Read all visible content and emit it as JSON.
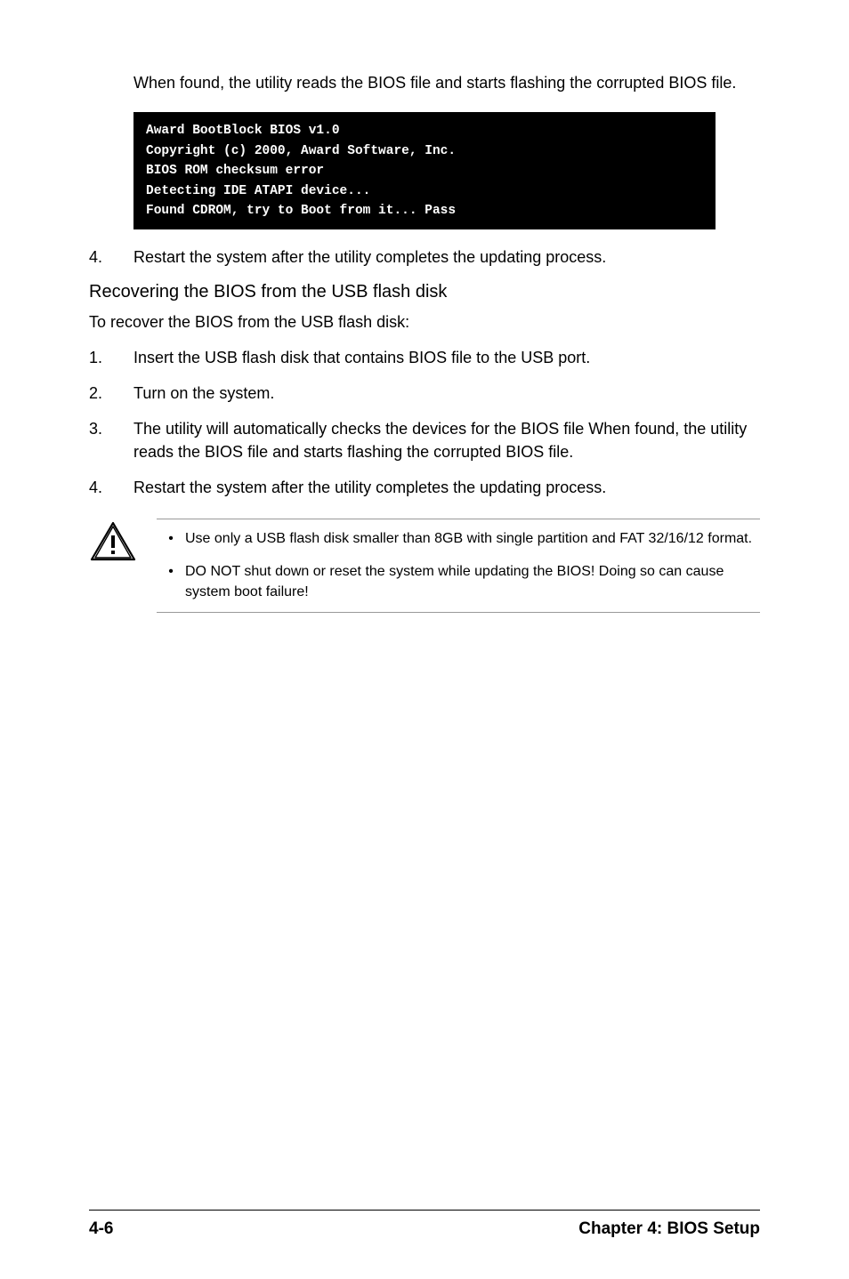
{
  "intro": "When found, the utility reads the BIOS file and starts flashing the corrupted BIOS file.",
  "code_lines": "Award BootBlock BIOS v1.0\nCopyright (c) 2000, Award Software, Inc.\nBIOS ROM checksum error\nDetecting IDE ATAPI device...\nFound CDROM, try to Boot from it... Pass",
  "step4a": {
    "num": "4.",
    "text": "Restart the system after the utility completes the updating process."
  },
  "heading": "Recovering the BIOS from the USB flash disk",
  "subtext": "To recover the BIOS from the USB flash disk:",
  "steps": [
    {
      "num": "1.",
      "text": "Insert the USB flash disk that contains BIOS file to the USB port."
    },
    {
      "num": "2.",
      "text": "Turn on the system."
    },
    {
      "num": "3.",
      "text": "The utility will automatically checks the devices for the BIOS file When found, the utility reads the BIOS file and starts flashing the corrupted BIOS file."
    },
    {
      "num": "4.",
      "text": "Restart the system after the utility completes the updating process."
    }
  ],
  "warnings": [
    {
      "bullet": "•",
      "text": "Use only a USB flash disk smaller than 8GB with single partition and FAT 32/16/12 format."
    },
    {
      "bullet": "•",
      "text": "DO NOT shut down or reset the system while updating the BIOS! Doing so can cause system boot failure!"
    }
  ],
  "footer": {
    "left": "4-6",
    "right": "Chapter 4: BIOS Setup"
  }
}
